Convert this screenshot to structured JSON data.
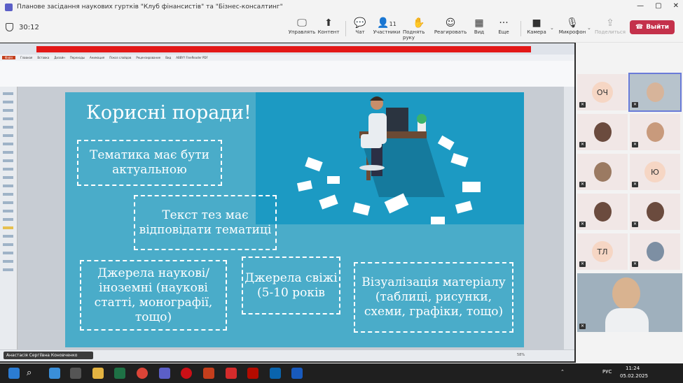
{
  "window": {
    "title": "Планове засідання наукових гуртків \"Клуб фінансистів\" та \"Бізнес-консалтинг\"",
    "controls": [
      "—",
      "▢",
      "✕"
    ]
  },
  "meeting": {
    "timer": "30:12",
    "buttons": {
      "manage": "Управлять",
      "content": "Контент",
      "chat": "Чат",
      "participants": "Участники",
      "participants_count": "11",
      "raise_hand": "Поднять руку",
      "react": "Реагировать",
      "view": "Вид",
      "more": "Еще",
      "camera": "Камера",
      "mic": "Микрофон",
      "share": "Поделиться",
      "leave": "Выйти"
    }
  },
  "powerpoint": {
    "tabs": [
      "Файл",
      "Главная",
      "Вставка",
      "Дизайн",
      "Переходы",
      "Анимация",
      "Показ слайдов",
      "Рецензирование",
      "Вид",
      "ABBYY FineReader PDF"
    ],
    "status": {
      "zoom": "58%"
    }
  },
  "slide": {
    "title": "Корисні поради!",
    "tips": [
      "Тематика має бути актуальною",
      "Текст тез має відповідати тематиці",
      "Джерела наукові/іноземні (наукові статті, монографії, тощо)",
      "Джерела свіжі (5-10 років",
      "Візуалізація матеріалу (таблиці, рисунки, схеми, графіки, тощо)"
    ]
  },
  "presenter": {
    "name": "Анастасія Сергіївна Коновченко"
  },
  "participants": {
    "initials": [
      "ОЧ",
      "Ю",
      "ТЛ"
    ]
  },
  "taskbar": {
    "language": "РУС",
    "time": "11:24",
    "date": "05.02.2025"
  }
}
